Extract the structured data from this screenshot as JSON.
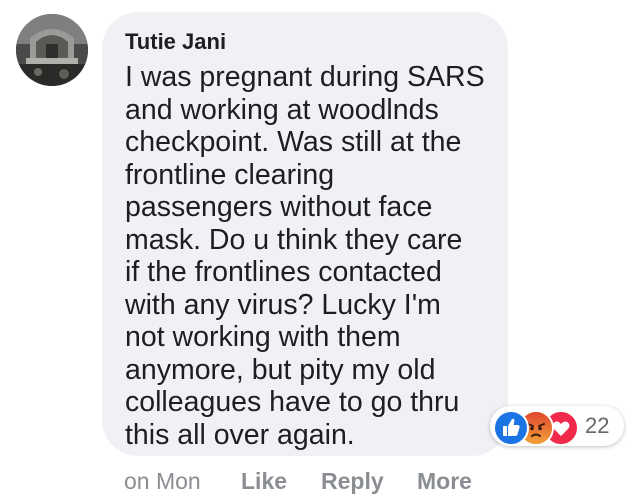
{
  "comment": {
    "author": "Tutie Jani",
    "avatar_icon": "profile-photo-icon",
    "text_lines": [
      "I was pregnant during SARS",
      "and working at woodlnds",
      "checkpoint. Was still at the",
      "frontline clearing",
      "passengers without face",
      "mask. Do u think they care",
      "if the frontlines contacted",
      "with any virus? Lucky I'm",
      "not working with them",
      "anymore, but pity my old",
      "colleagues have to go thru",
      "this all over again."
    ]
  },
  "reactions": {
    "icons": [
      "like-reaction-icon",
      "angry-reaction-icon",
      "love-reaction-icon"
    ],
    "count": "22",
    "colors": {
      "like": "#1b74e4",
      "angry": "#e8812e",
      "love": "#f0284a"
    }
  },
  "actions": {
    "timestamp": "on Mon",
    "like_label": "Like",
    "reply_label": "Reply",
    "more_label": "More"
  },
  "colors": {
    "bubble_bg": "#f0f1f4",
    "text": "#1c1e21",
    "muted": "#8a8d91"
  }
}
